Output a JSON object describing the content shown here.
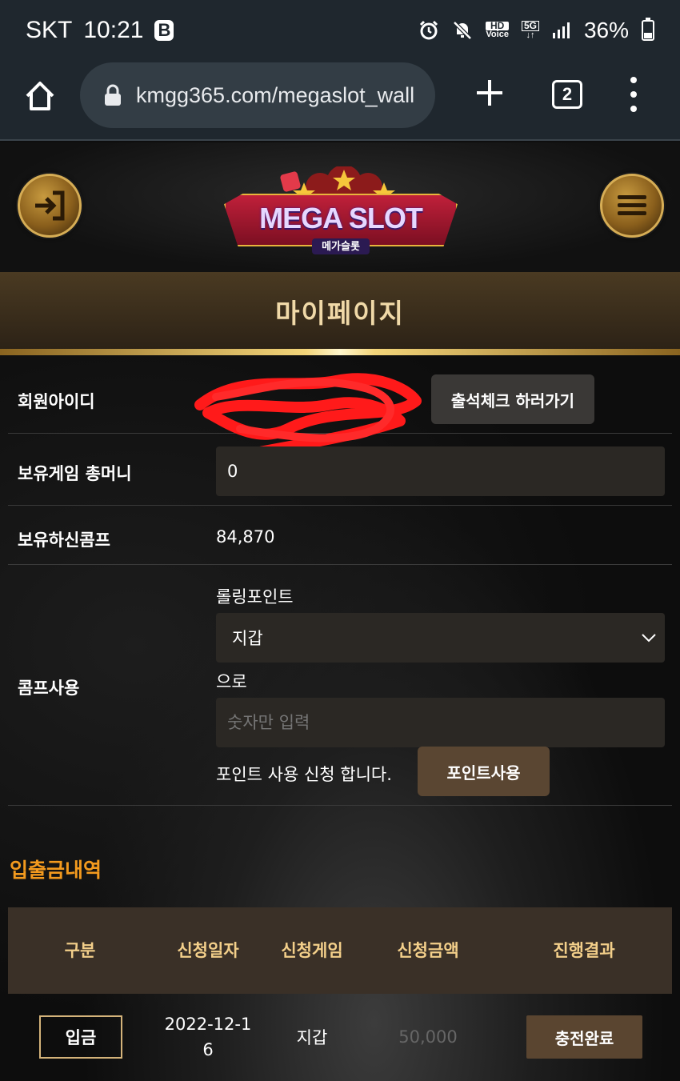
{
  "status_bar": {
    "carrier": "SKT",
    "time": "10:21",
    "app_badge": "B",
    "hd_label": "HD",
    "voice_label": "Voice",
    "net_label": "5G",
    "battery": "36%",
    "battery_level": 0.36
  },
  "browser": {
    "url": "kmgg365.com/megaslot_wall",
    "tab_count": "2"
  },
  "site": {
    "logo_text": "MEGA SLOT",
    "logo_sub": "메가슬롯"
  },
  "page": {
    "title": "마이페이지"
  },
  "profile": {
    "member_id_label": "회원아이디",
    "attendance_button": "출석체크 하러가기",
    "total_money_label": "보유게임 총머니",
    "total_money_value": "0",
    "comp_label": "보유하신콤프",
    "comp_value": "84,870",
    "comp_use_label": "콤프사용",
    "rolling_point_label": "롤링포인트",
    "wallet_select_value": "지갑",
    "to_text": "으로",
    "amount_placeholder": "숫자만 입력",
    "apply_text": "포인트 사용 신청 합니다.",
    "use_points_button": "포인트사용"
  },
  "history": {
    "title": "입출금내역",
    "columns": [
      "구분",
      "신청일자",
      "신청게임",
      "신청금액",
      "진행결과"
    ],
    "rows": [
      {
        "type": "입금",
        "date": "2022-12-16",
        "game": "지갑",
        "amount": "50,000",
        "result": "충전완료"
      }
    ]
  }
}
